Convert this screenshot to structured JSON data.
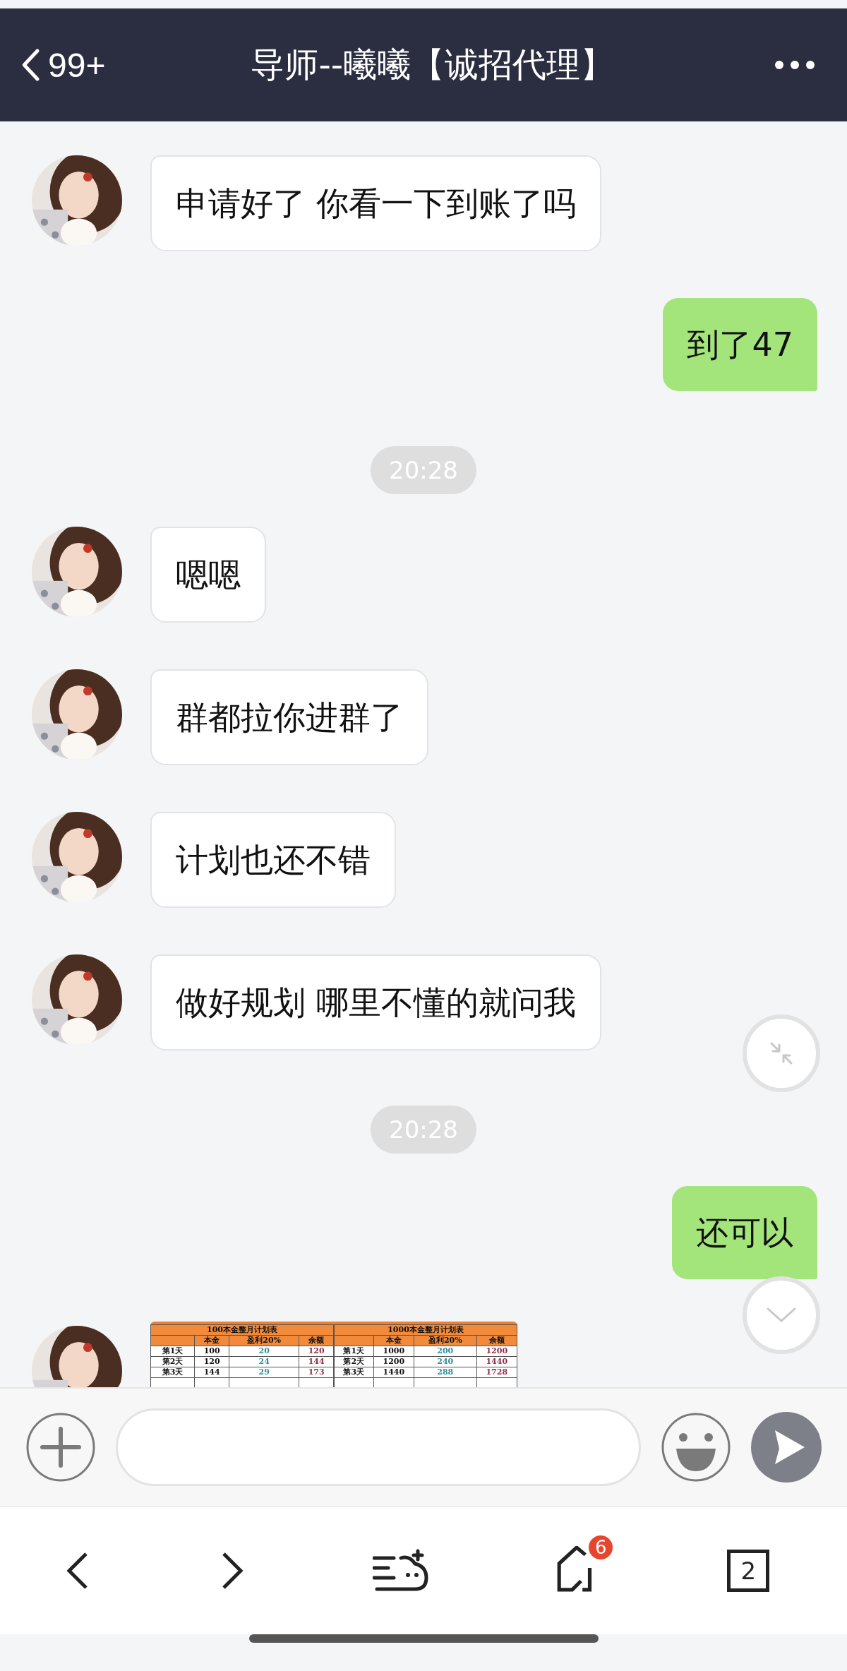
{
  "header": {
    "back_count": "99+",
    "title": "导师--曦曦【诚招代理】"
  },
  "messages": [
    {
      "kind": "text",
      "sent": false,
      "text": "申请好了 你看一下到账了吗"
    },
    {
      "kind": "text",
      "sent": true,
      "text": "到了47"
    },
    {
      "kind": "time",
      "text": "20:28"
    },
    {
      "kind": "text",
      "sent": false,
      "text": "嗯嗯"
    },
    {
      "kind": "text",
      "sent": false,
      "text": "群都拉你进群了"
    },
    {
      "kind": "text",
      "sent": false,
      "text": "计划也还不错"
    },
    {
      "kind": "text",
      "sent": false,
      "text": "做好规划 哪里不懂的就问我"
    },
    {
      "kind": "time",
      "text": "20:28"
    },
    {
      "kind": "text",
      "sent": true,
      "text": "还可以"
    },
    {
      "kind": "table",
      "sent": false,
      "blocks": [
        {
          "title": "100本金整月计划表",
          "columns": [
            "",
            "本金",
            "盈利20%",
            "余额"
          ],
          "rows": [
            [
              "第1天",
              "100",
              "20",
              "120"
            ],
            [
              "第2天",
              "120",
              "24",
              "144"
            ],
            [
              "第3天",
              "144",
              "29",
              "173"
            ]
          ]
        },
        {
          "title": "1000本金整月计划表",
          "columns": [
            "",
            "本金",
            "盈利20%",
            "余额"
          ],
          "rows": [
            [
              "第1天",
              "1000",
              "200",
              "1200"
            ],
            [
              "第2天",
              "1200",
              "240",
              "1440"
            ],
            [
              "第3天",
              "1440",
              "288",
              "1728"
            ]
          ]
        }
      ]
    }
  ],
  "nav": {
    "home_badge": "6",
    "tab_count": "2"
  }
}
